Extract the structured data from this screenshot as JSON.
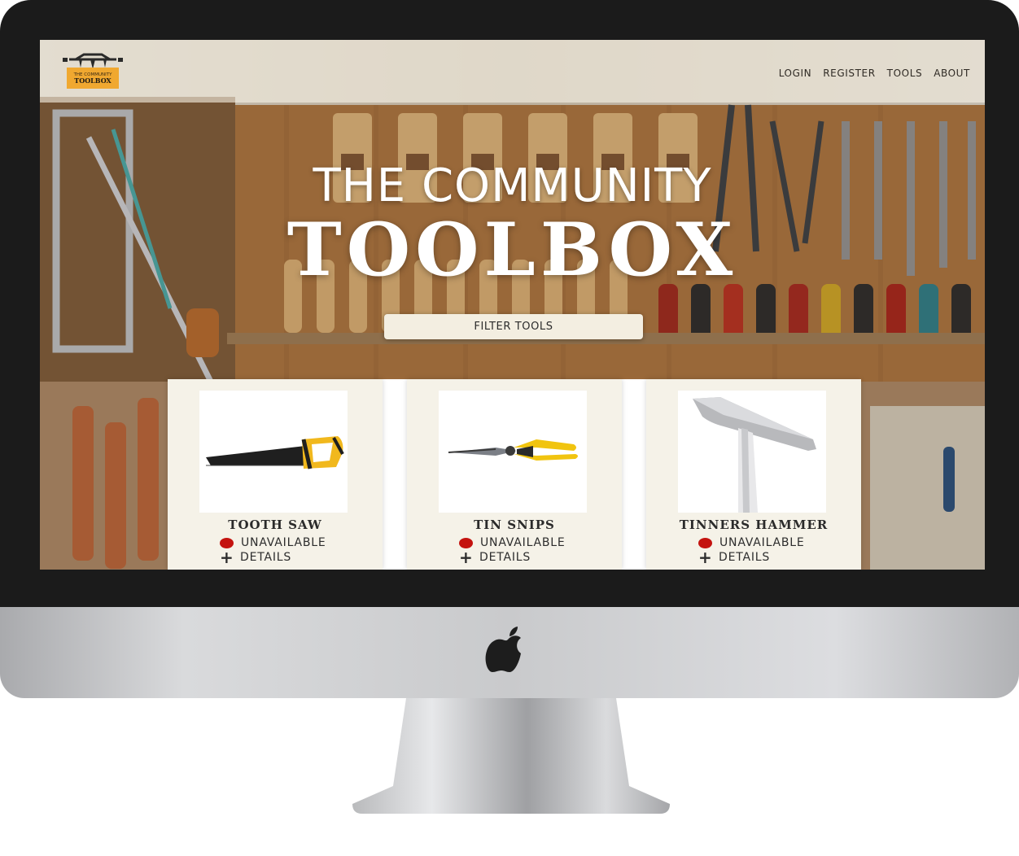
{
  "site": {
    "logo_text_top": "THE COMMUNITY",
    "logo_text_bottom": "TOOLBOX",
    "nav": [
      "LOGIN",
      "REGISTER",
      "TOOLS",
      "ABOUT"
    ]
  },
  "hero": {
    "line1": "THE COMMUNITY",
    "line2": "TOOLBOX",
    "filter_button": "FILTER TOOLS"
  },
  "tools": [
    {
      "name": "TOOTH SAW",
      "status": "UNAVAILABLE",
      "details": "DETAILS",
      "icon": "saw-icon"
    },
    {
      "name": "TIN SNIPS",
      "status": "UNAVAILABLE",
      "details": "DETAILS",
      "icon": "tin-snips-icon"
    },
    {
      "name": "TINNERS HAMMER",
      "status": "UNAVAILABLE",
      "details": "DETAILS",
      "icon": "hammer-icon"
    }
  ],
  "colors": {
    "status_unavailable": "#c4130f",
    "card_background": "#f5f2e8",
    "logo_orange": "#f0a830"
  }
}
